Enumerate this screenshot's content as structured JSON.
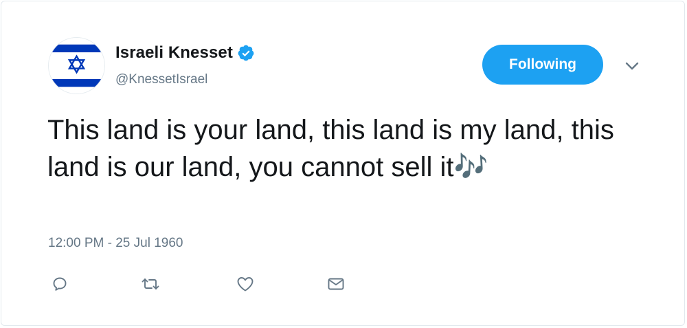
{
  "tweet": {
    "author": {
      "display_name": "Israeli Knesset",
      "handle": "@KnessetIsrael",
      "verified": true,
      "avatar_icon": "israel-flag-icon"
    },
    "follow_button_label": "Following",
    "text": "This land is your land, this land is my land, this land is our land, you cannot sell it🎶",
    "timestamp": "12:00 PM - 25 Jul 1960",
    "actions": [
      "reply-icon",
      "retweet-icon",
      "like-icon",
      "direct-message-icon"
    ]
  },
  "colors": {
    "accent": "#1da1f2",
    "text": "#14171a",
    "secondary_text": "#657786",
    "flag_blue": "#0038b8",
    "icon_gray": "#657786"
  }
}
